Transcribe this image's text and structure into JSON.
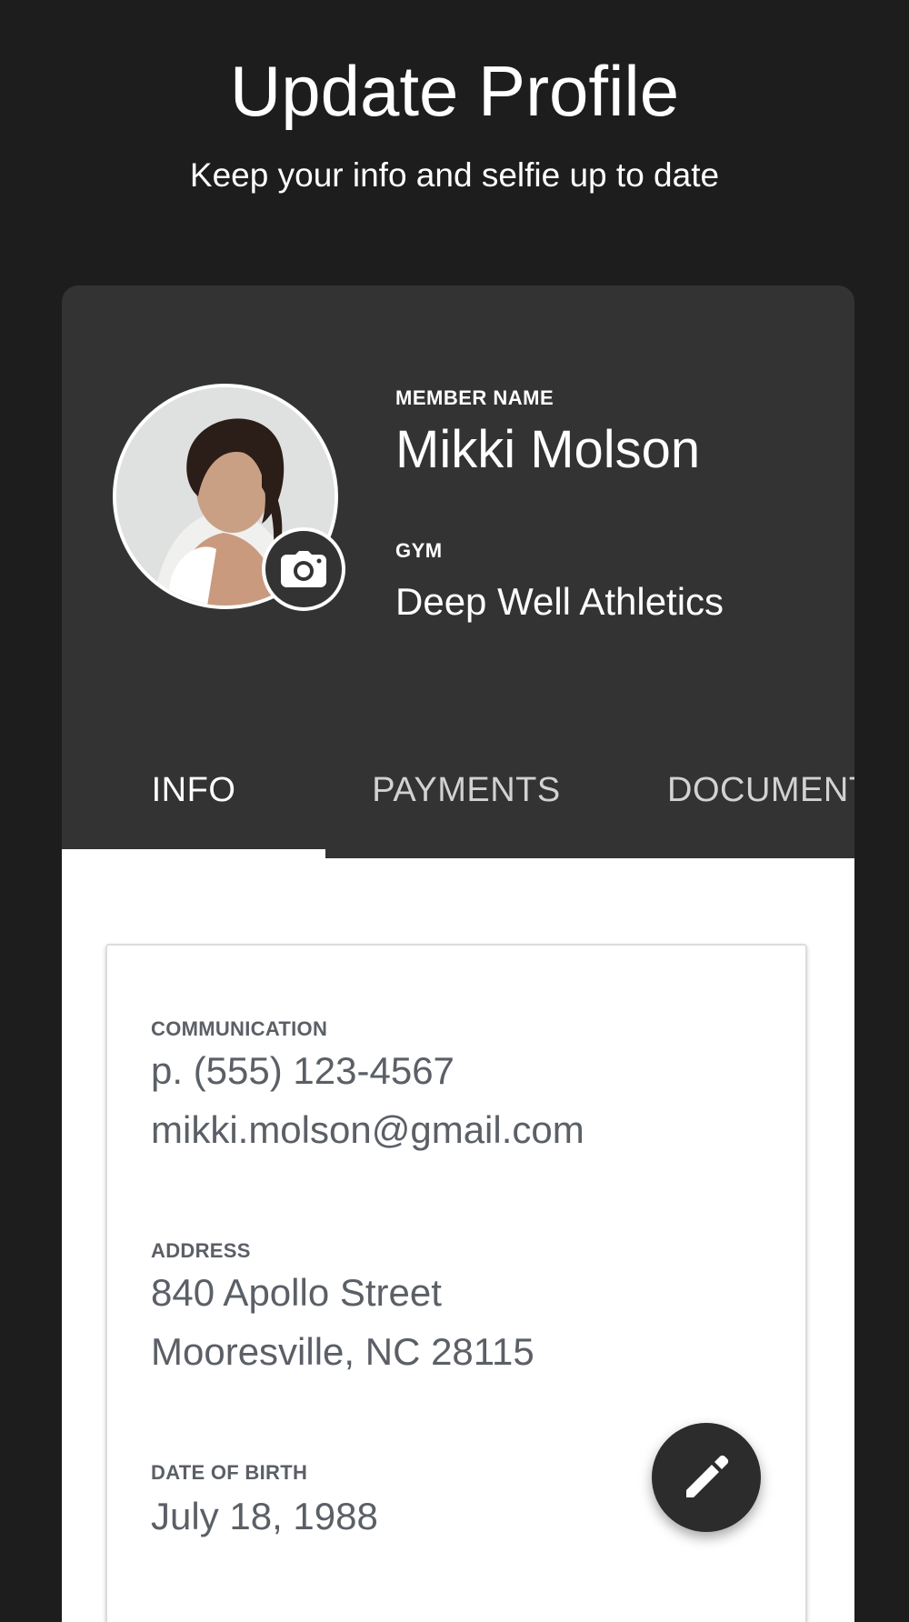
{
  "header": {
    "title": "Update Profile",
    "subtitle": "Keep your info and selfie up to date"
  },
  "profile": {
    "avatar_icon": "member-photo",
    "camera_icon": "camera-icon",
    "member_name_label": "MEMBER NAME",
    "member_name": "Mikki Molson",
    "gym_label": "GYM",
    "gym_name": "Deep Well Athletics"
  },
  "tabs": [
    {
      "label": "INFO",
      "active": true
    },
    {
      "label": "PAYMENTS",
      "active": false
    },
    {
      "label": "DOCUMENTS",
      "active": false
    }
  ],
  "info": {
    "communication_label": "COMMUNICATION",
    "phone": "p. (555) 123-4567",
    "email": "mikki.molson@gmail.com",
    "address_label": "ADDRESS",
    "address_line1": "840 Apollo Street",
    "address_line2": "Mooresville, NC 28115",
    "dob_label": "DATE OF BIRTH",
    "dob": "July 18, 1988"
  },
  "fab": {
    "icon": "pencil-icon"
  },
  "colors": {
    "background": "#1d1d1d",
    "card": "#333334",
    "content": "#ffffff",
    "text_muted": "#5b5f66",
    "tab_inactive": "#d2d2d2"
  }
}
